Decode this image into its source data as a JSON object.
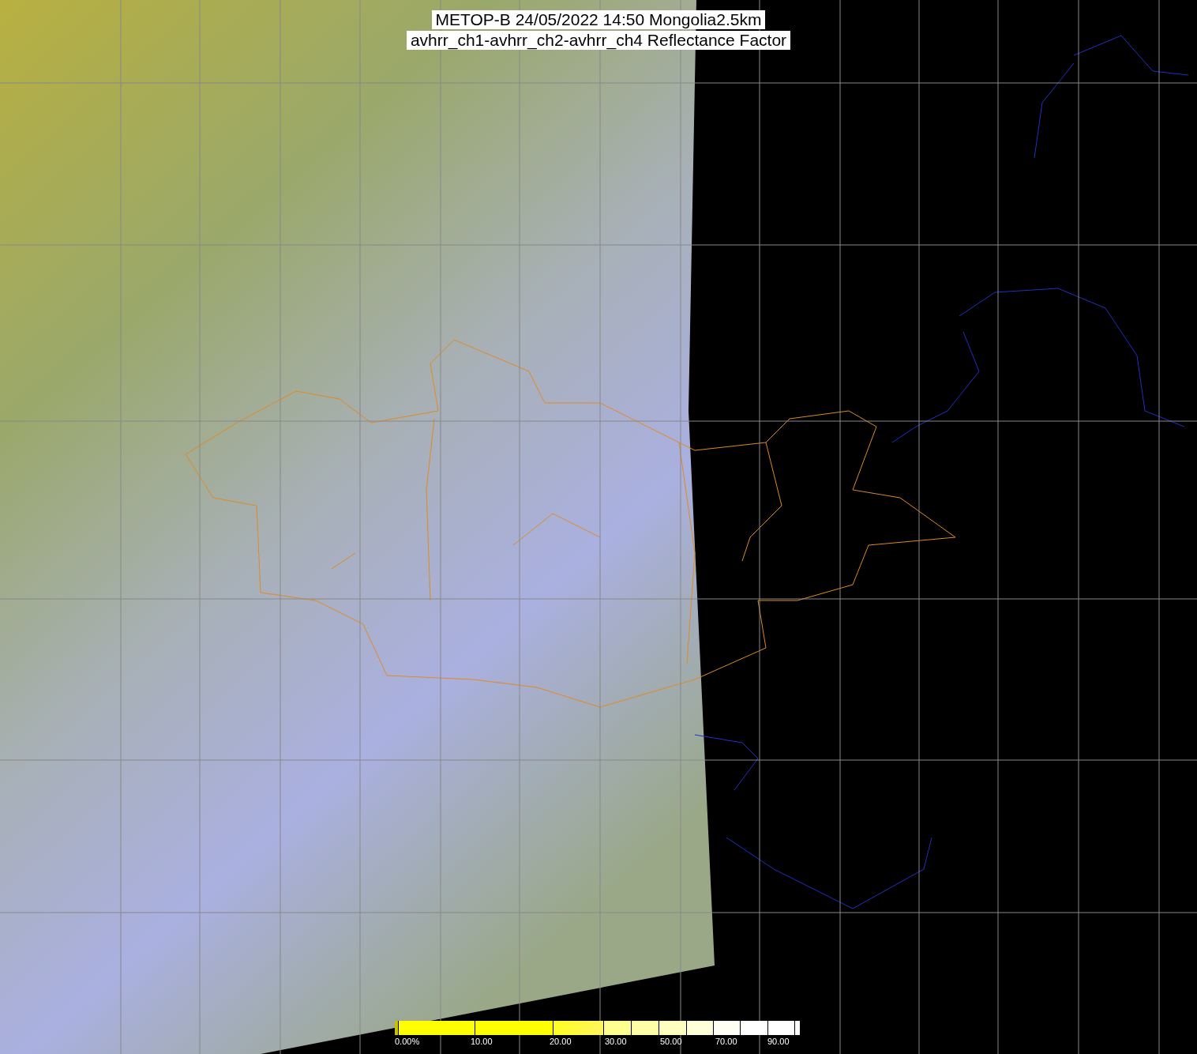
{
  "title": {
    "lines": [
      "METOP-B 24/05/2022 14:50 Mongolia2.5km",
      "avhrr_ch1-avhrr_ch2-avhrr_ch4 Reflectance Factor"
    ]
  },
  "colorbar": {
    "labels": [
      "0.00%",
      "10.00",
      "20.00",
      "30.00",
      "50.00",
      "70.00",
      "90.00"
    ]
  }
}
